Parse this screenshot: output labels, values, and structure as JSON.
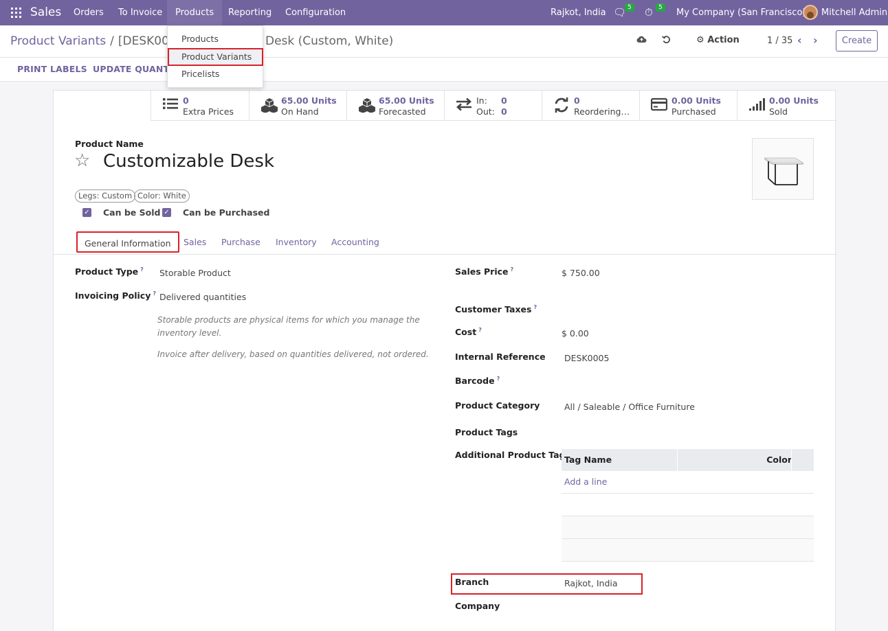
{
  "navbar": {
    "app_name": "Sales",
    "menus": [
      "Orders",
      "To Invoice",
      "Products",
      "Reporting",
      "Configuration"
    ],
    "branch": "Rajkot, India",
    "messages_count": "5",
    "activities_count": "5",
    "company": "My Company (San Francisco)",
    "user": "Mitchell Admin"
  },
  "products_dropdown": {
    "items": [
      "Products",
      "Product Variants",
      "Pricelists"
    ]
  },
  "control_panel": {
    "breadcrumb_parent": "Product Variants",
    "breadcrumb_current_visible_start": "[DESK000",
    "breadcrumb_current_visible_end": "Desk (Custom, White)",
    "action_label": "Action",
    "pager": "1 / 35",
    "create_label": "Create"
  },
  "status_bar": {
    "buttons": [
      "PRINT LABELS",
      "UPDATE QUANTIT"
    ]
  },
  "smart_buttons": [
    {
      "value": "0",
      "label": "Extra Prices",
      "icon": "list-icon"
    },
    {
      "value": "65.00 Units",
      "label": "On Hand",
      "icon": "cubes-icon"
    },
    {
      "value": "65.00 Units",
      "label": "Forecasted",
      "icon": "cubes-icon"
    },
    {
      "value_in": "0",
      "value_out": "0",
      "label_in": "In:",
      "label_out": "Out:",
      "icon": "exchange-icon"
    },
    {
      "value": "0",
      "label": "Reordering…",
      "icon": "refresh-icon"
    },
    {
      "value": "0.00 Units",
      "label": "Purchased",
      "icon": "credit-card-icon"
    },
    {
      "value": "0.00 Units",
      "label": "Sold",
      "icon": "signal-icon"
    }
  ],
  "form": {
    "product_name_label": "Product Name",
    "product_name": "Customizable Desk",
    "attribute_tags": [
      "Legs: Custom",
      "Color: White"
    ],
    "can_be_sold_label": "Can be Sold",
    "can_be_purchased_label": "Can be Purchased",
    "tabs": [
      "General Information",
      "Sales",
      "Purchase",
      "Inventory",
      "Accounting"
    ],
    "left": {
      "product_type_label": "Product Type",
      "product_type": "Storable Product",
      "invoicing_policy_label": "Invoicing Policy",
      "invoicing_policy": "Delivered quantities",
      "help1": "Storable products are physical items for which you manage the inventory level.",
      "help2": "Invoice after delivery, based on quantities delivered, not ordered."
    },
    "right": {
      "sales_price_label": "Sales Price",
      "sales_price": "$ 750.00",
      "customer_taxes_label": "Customer Taxes",
      "cost_label": "Cost",
      "cost": "$ 0.00",
      "internal_ref_label": "Internal Reference",
      "internal_ref": "DESK0005",
      "barcode_label": "Barcode",
      "category_label": "Product Category",
      "category": "All / Saleable / Office Furniture",
      "product_tags_label": "Product Tags",
      "additional_tag_label": "Additional Product Tag",
      "tag_table_headers": [
        "Tag Name",
        "Color"
      ],
      "add_line": "Add a line",
      "branch_label": "Branch",
      "branch": "Rajkot, India",
      "company_label": "Company"
    }
  },
  "colors": {
    "brand": "#71639e",
    "highlight_border": "#d9202a",
    "badge": "#28a745"
  }
}
